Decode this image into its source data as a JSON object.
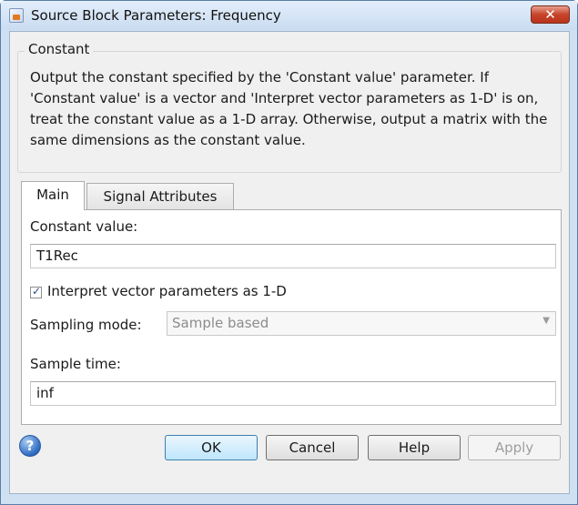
{
  "window": {
    "title": "Source Block Parameters: Frequency",
    "close_glyph": "✕"
  },
  "block": {
    "group_label": "Constant",
    "description": "Output the constant specified by the 'Constant value' parameter. If 'Constant value' is a vector and 'Interpret vector parameters as 1-D' is on, treat the constant value as a 1-D array. Otherwise, output a matrix with the same dimensions as the constant value."
  },
  "tabs": [
    {
      "label": "Main",
      "selected": true
    },
    {
      "label": "Signal Attributes",
      "selected": false
    }
  ],
  "main": {
    "constant_value_label": "Constant value:",
    "constant_value": "T1Rec",
    "interpret_label": "Interpret vector parameters as 1-D",
    "interpret_checked": true,
    "sampling_mode_label": "Sampling mode:",
    "sampling_mode_value": "Sample based",
    "sample_time_label": "Sample time:",
    "sample_time_value": "inf"
  },
  "buttons": {
    "help_icon": "?",
    "ok": "OK",
    "cancel": "Cancel",
    "help": "Help",
    "apply": "Apply"
  },
  "icons": {
    "check": "✓",
    "dropdown": "▼"
  }
}
